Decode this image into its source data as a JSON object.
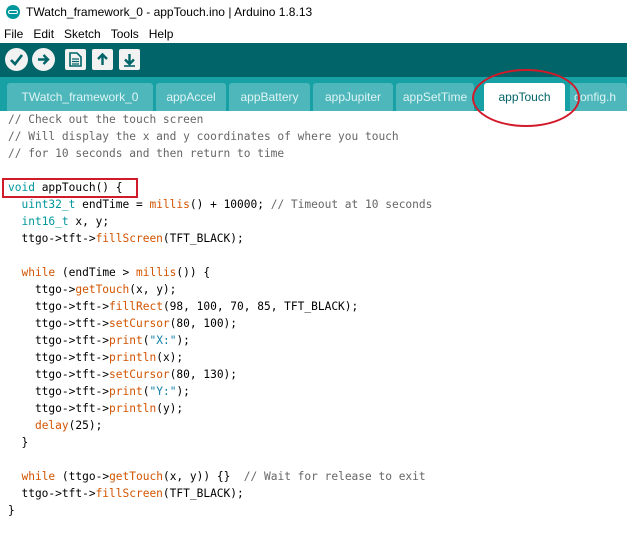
{
  "window": {
    "title": "TWatch_framework_0 - appTouch.ino | Arduino 1.8.13"
  },
  "menu": [
    "File",
    "Edit",
    "Sketch",
    "Tools",
    "Help"
  ],
  "toolbar": {
    "buttons": [
      {
        "name": "verify-button",
        "icon": "check-icon"
      },
      {
        "name": "upload-button",
        "icon": "arrow-right-icon"
      },
      {
        "name": "new-button",
        "icon": "new-file-icon"
      },
      {
        "name": "open-button",
        "icon": "arrow-up-icon"
      },
      {
        "name": "save-button",
        "icon": "arrow-down-icon"
      }
    ]
  },
  "tabs": [
    "TWatch_framework_0",
    "appAccel",
    "appBattery",
    "appJupiter",
    "appSetTime",
    "appTouch",
    "config.h"
  ],
  "active_tab": "appTouch",
  "code_lines": [
    "// Check out the touch screen",
    "// Will display the x and y coordinates of where you touch",
    "// for 10 seconds and then return to time",
    "",
    "void appTouch() {",
    "  uint32_t endTime = millis() + 10000; // Timeout at 10 seconds",
    "  int16_t x, y;",
    "  ttgo->tft->fillScreen(TFT_BLACK);",
    "",
    "  while (endTime > millis()) {",
    "    ttgo->getTouch(x, y);",
    "    ttgo->tft->fillRect(98, 100, 70, 85, TFT_BLACK);",
    "    ttgo->tft->setCursor(80, 100);",
    "    ttgo->tft->print(\"X:\");",
    "    ttgo->tft->println(x);",
    "    ttgo->tft->setCursor(80, 130);",
    "    ttgo->tft->print(\"Y:\");",
    "    ttgo->tft->println(y);",
    "    delay(25);",
    "  }",
    "",
    "  while (ttgo->getTouch(x, y)) {}  // Wait for release to exit",
    "  ttgo->tft->fillScreen(TFT_BLACK);",
    "}"
  ],
  "colors": {
    "toolbar": "#006468",
    "tabbar": "#17a1a5",
    "highlight": "#d11a2a"
  }
}
